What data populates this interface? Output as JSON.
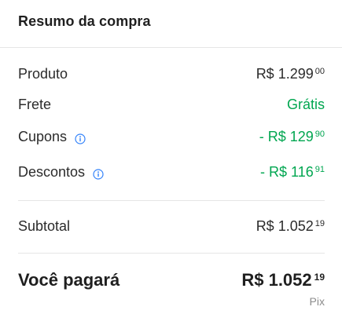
{
  "header": {
    "title": "Resumo da compra"
  },
  "rows": {
    "produto": {
      "label": "Produto",
      "value_main": "R$ 1.299",
      "value_cents": "00"
    },
    "frete": {
      "label": "Frete",
      "value": "Grátis"
    },
    "cupons": {
      "label": "Cupons",
      "icon": "info-icon",
      "value_main": "- R$ 129",
      "value_cents": "90"
    },
    "descontos": {
      "label": "Descontos",
      "icon": "info-icon",
      "value_main": "- R$ 116",
      "value_cents": "91"
    },
    "subtotal": {
      "label": "Subtotal",
      "value_main": "R$ 1.052",
      "value_cents": "19"
    }
  },
  "total": {
    "label": "Você pagará",
    "value_main": "R$ 1.052",
    "value_cents": "19",
    "payment_method": "Pix"
  },
  "colors": {
    "discount_green": "#00a650",
    "info_blue": "#3483fa",
    "text": "#1f1f1f",
    "muted": "#8c8c8c",
    "divider": "#e6e6e6"
  }
}
